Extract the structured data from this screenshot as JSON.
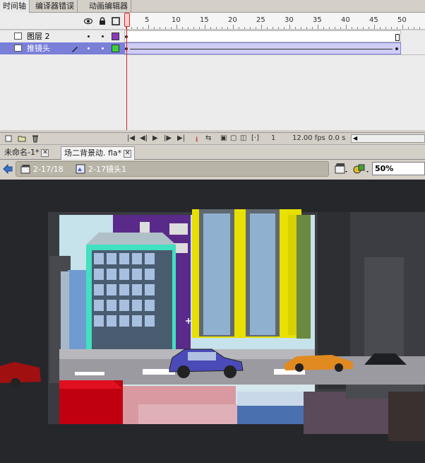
{
  "panel_tabs": {
    "timeline": "时间轴",
    "compiler_errors": "编译器错误",
    "motion_editor": "动画编辑器"
  },
  "layers": [
    {
      "name": "图层 2",
      "color": "#8b3ab8",
      "selected": false
    },
    {
      "name": "推镜头",
      "color": "#3cd03c",
      "selected": true
    }
  ],
  "ruler": {
    "labels": [
      "1",
      "5",
      "10",
      "15",
      "20",
      "25",
      "30",
      "35",
      "40",
      "45",
      "50"
    ]
  },
  "timeline_status": {
    "current_frame": "1",
    "fps": "12.00 fps",
    "elapsed": "0.0 s"
  },
  "doc_tabs": [
    {
      "label": "未命名-1*",
      "active": false
    },
    {
      "label": "场二背景动. fla*",
      "active": true
    }
  ],
  "breadcrumbs": [
    {
      "label": "2-17/18",
      "icon": "scene-icon"
    },
    {
      "label": "2-17镜头1",
      "icon": "symbol-icon"
    }
  ],
  "zoom": {
    "value": "50%"
  },
  "colors": {
    "selected_layer": "#7a7fd8",
    "tween_span": "#cfcdf5",
    "playhead": "#e02020",
    "stage_bg": "#26272b"
  }
}
